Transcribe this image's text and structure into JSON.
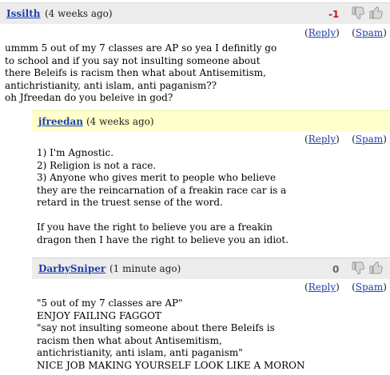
{
  "comments": [
    {
      "author": "Issilth",
      "time": "(4 weeks ago)",
      "score": "-1",
      "reply_label": "Reply",
      "spam_label": "Spam",
      "body": "ummm 5 out of my 7 classes are AP so yea I definitly go\nto school and if you say not insulting someone about\nthere Beleifs is racism then what about Antisemitism,\nantichristianity, anti islam, anti paganism??\noh Jfreedan do you beleive in god?"
    },
    {
      "author": "jfreedan",
      "time": "(4 weeks ago)",
      "reply_label": "Reply",
      "spam_label": "Spam",
      "body": "1) I'm Agnostic.\n2) Religion is not a race.\n3) Anyone who gives merit to people who believe\nthey are the reincarnation of a freakin race car is a\nretard in the truest sense of the word.\n\nIf you have the right to believe you are a freakin\ndragon then I have the right to believe you an idiot."
    },
    {
      "author": "DarbySniper",
      "time": "(1 minute ago)",
      "score": "0",
      "reply_label": "Reply",
      "spam_label": "Spam",
      "body": "\"5 out of my 7 classes are AP\"\nENJOY FAILING FAGGOT\n\"say not insulting someone about there Beleifs is\nracism then what about Antisemitism,\nantichristianity, anti islam, anti paganism\"\nNICE JOB MAKING YOURSELF LOOK LIKE A MORON"
    }
  ],
  "icons": {
    "thumb_down": "thumbs-down-icon",
    "thumb_up": "thumbs-up-icon"
  },
  "colors": {
    "link": "#1d3faa",
    "negative_score": "#d01515",
    "header_gray": "#ececec",
    "header_yellow": "#ffffcc"
  }
}
